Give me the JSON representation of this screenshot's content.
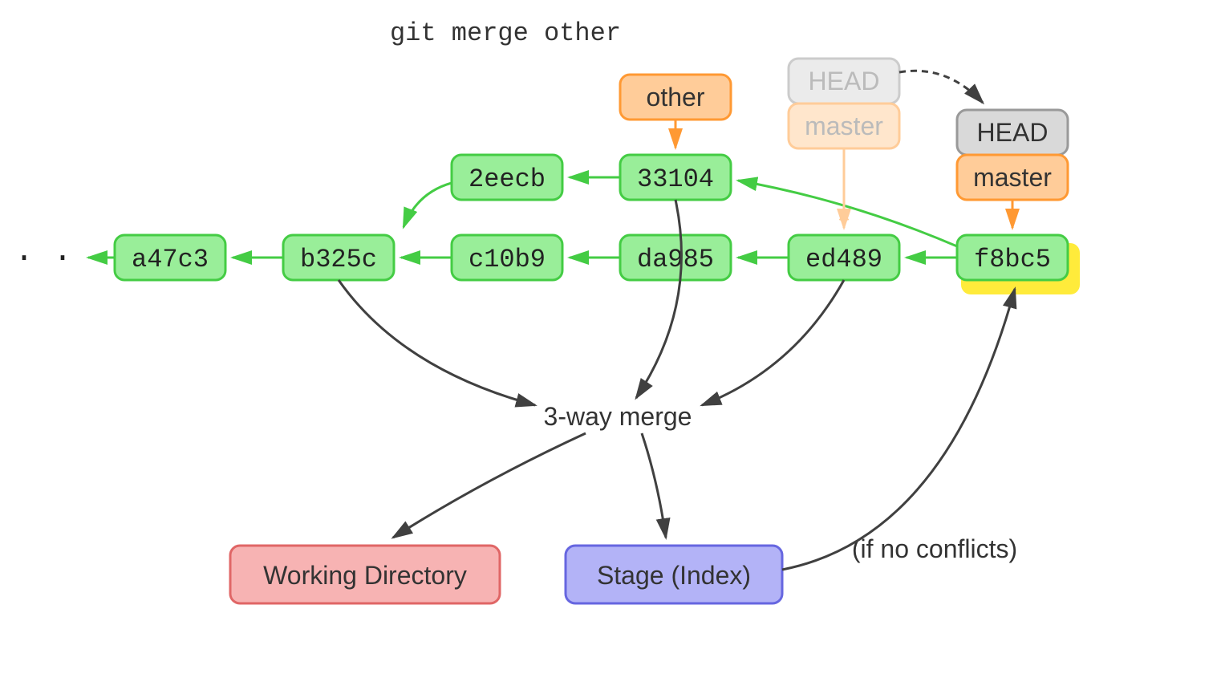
{
  "title": "git merge other",
  "commits": {
    "c1": "a47c3",
    "c2": "b325c",
    "c3": "c10b9",
    "c4": "da985",
    "c5": "ed489",
    "c6": "f8bc5",
    "b1": "2eecb",
    "b2": "33104"
  },
  "refs": {
    "other": "other",
    "head": "HEAD",
    "master": "master",
    "head_old": "HEAD",
    "master_old": "master"
  },
  "labels": {
    "merge": "3-way merge",
    "workdir": "Working Directory",
    "stage": "Stage (Index)",
    "note": "(if no conflicts)",
    "dots": "· · ·"
  }
}
